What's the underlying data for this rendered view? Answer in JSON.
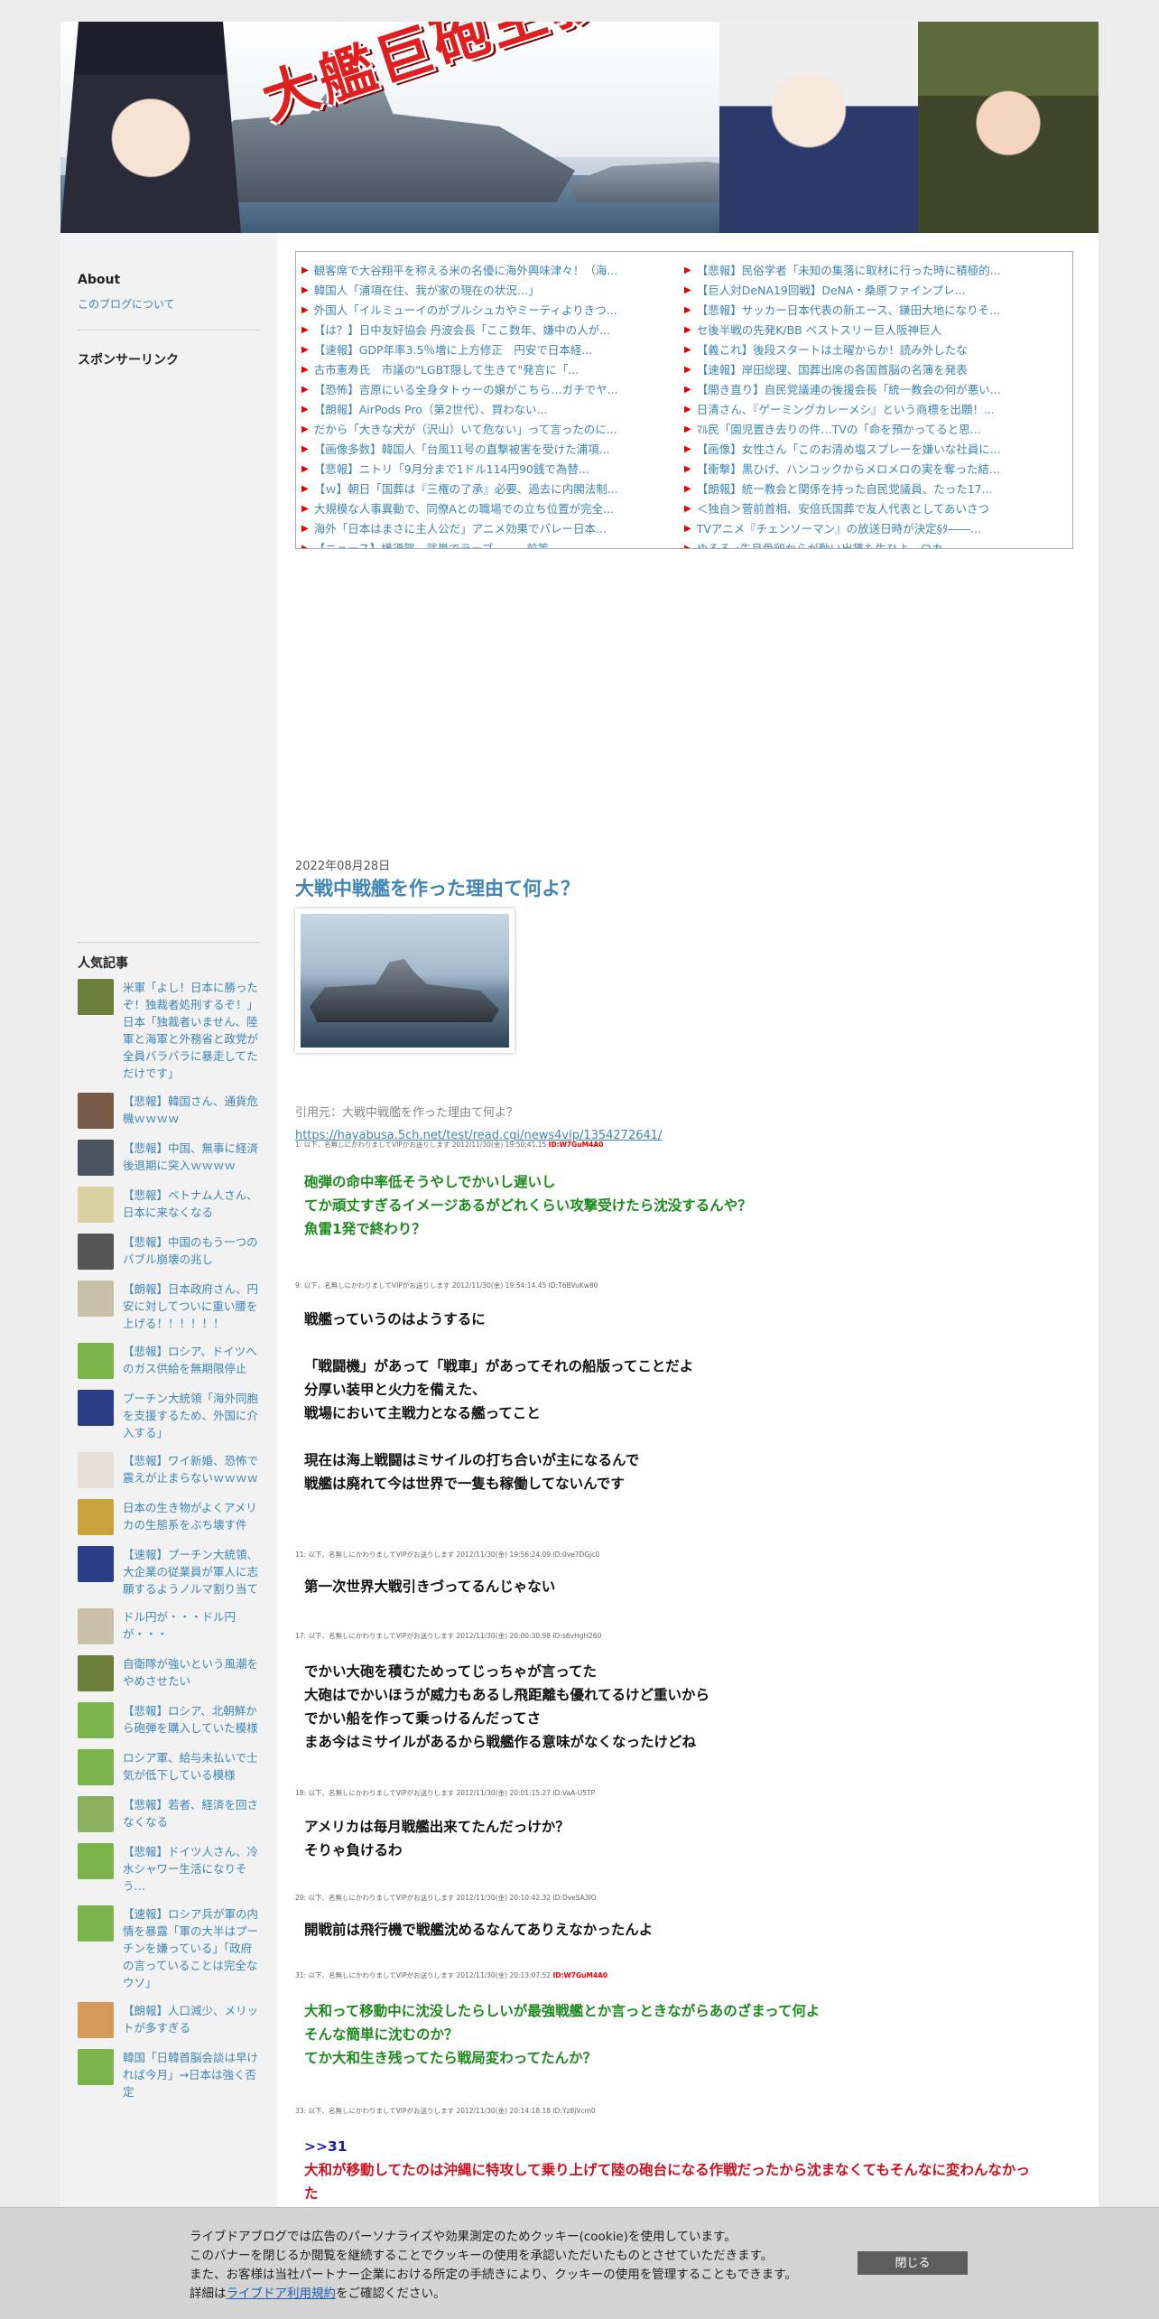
{
  "banner": {
    "title": "大艦巨砲主義！"
  },
  "sidebar": {
    "about_heading": "About",
    "about_link": "このブログについて",
    "sponsor_heading": "スポンサーリンク",
    "popular_heading": "人気記事",
    "popular": [
      {
        "text": "米軍「よし！日本に勝ったぞ！独裁者処刑するぞ！」日本「独裁者いません、陸軍と海軍と外務省と政党が全員バラバラに暴走してただけです」",
        "color": "#6b7f3a"
      },
      {
        "text": "【悲報】韓国さん、通貨危機ｗｗｗｗ",
        "color": "#7a5a48"
      },
      {
        "text": "【悲報】中国、無事に経済後退期に突入ｗｗｗｗ",
        "color": "#4a5560"
      },
      {
        "text": "【悲報】ベトナム人さん、日本に来なくなる",
        "color": "#d9d2a0"
      },
      {
        "text": "【悲報】中国のもう一つのバブル崩壊の兆し",
        "color": "#555"
      },
      {
        "text": "【朗報】日本政府さん、円安に対してついに重い腰を上げる！！！！！！",
        "color": "#c8c0a8"
      },
      {
        "text": "【悲報】ロシア、ドイツへのガス供給を無期限停止",
        "color": "#7bb44a"
      },
      {
        "text": "プーチン大統領「海外同胞を支援するため、外国に介入する」",
        "color": "#2d3e88"
      },
      {
        "text": "【悲報】ワイ新婚、恐怖で震えが止まらないｗｗｗｗ",
        "color": "#e8e0d8"
      },
      {
        "text": "日本の生き物がよくアメリカの生態系をぶち壊す件",
        "color": "#c9a43a"
      },
      {
        "text": "【速報】プーチン大統領、大企業の従業員が軍人に志願するようノルマ割り当て",
        "color": "#2d3e88"
      },
      {
        "text": "ドル円が・・・ドル円が・・・",
        "color": "#c8c0a8"
      },
      {
        "text": "自衛隊が強いという風潮をやめさせたい",
        "color": "#6b7f3a"
      },
      {
        "text": "【悲報】ロシア、北朝鮮から砲弾を購入していた模様",
        "color": "#7bb44a"
      },
      {
        "text": "ロシア軍、給与未払いで士気が低下している模様",
        "color": "#7bb44a"
      },
      {
        "text": "【悲報】若者、経済を回さなくなる",
        "color": "#8ab060"
      },
      {
        "text": "【悲報】ドイツ人さん、冷水シャワー生活になりそう…",
        "color": "#7bb44a"
      },
      {
        "text": "【速報】ロシア兵が軍の内情を暴露「軍の大半はプーチンを嫌っている」「政府の言っていることは完全なウソ」",
        "color": "#7bb44a"
      },
      {
        "text": "【朗報】人口減少、メリットが多すぎる",
        "color": "#d89a5a"
      },
      {
        "text": "韓国「日韓首脳会談は早ければ今月」→日本は強く否定",
        "color": "#7bb44a"
      }
    ]
  },
  "rss": {
    "left": [
      "観客席で大谷翔平を称える米の名優に海外興味津々！（海...",
      "韓国人「浦項在住、我が家の現在の状況…」",
      "外国人「イルミューイのがプルシュカやミーティよりきつ...",
      "【は？】日中友好協会 丹波会長「ここ数年、嫌中の人が...",
      "【速報】GDP年率3.5％増に上方修正　円安で日本経...",
      "古市憲寿氏　市議の\"LGBT隠して生きて\"発言に「...",
      "【恐怖】吉原にいる全身タトゥーの嬢がこちら…ガチでヤ...",
      "【朗報】AirPods Pro（第2世代）、買わない...",
      "だから「大きな犬が（沢山）いて危ない」って言ったのに...",
      "【画像多数】韓国人「台風11号の直撃被害を受けた浦項...",
      "【悲報】ニトリ「9月分まで1ドル114円90銭で為替...",
      "【ｗ】朝日「国葬は『三権の了承』必要、過去に内閣法制...",
      "大規模な人事異動で、同僚Aとの職場での立ち位置が完全...",
      "海外「日本はまさに主人公だ」アニメ効果でバレー日本...",
      "【ニュース】横須賀　武巣でラーブ　...　前等"
    ],
    "right": [
      "【悲報】民俗学者「未知の集落に取材に行った時に積極的...",
      "【巨人対DeNA19回戦】DeNA・桑原ファインプレ...",
      "【悲報】サッカー日本代表の新エース、鎌田大地になりそ...",
      "セ後半戦の先発K/BB ベストスリー巨人阪神巨人",
      "【義これ】後段スタートは土曜からか！読み外したな",
      "【速報】岸田総理、国葬出席の各国首脳の名簿を発表",
      "【開き直り】自民党議連の後援会長「統一教会の何が悪い...",
      "日清さん、『ゲーミングカレーメシ』という商標を出願！...",
      "ﾏﾙ民「園児置き去りの件…TVの「命を預かってると思...",
      "【画像】女性さん「このお清め塩スプレーを嫌いな社員に...",
      "【衝撃】黒ひげ、ハンコックからメロメロの実を奪った結...",
      "【朗報】統一教会と関係を持った自民党議員、たった17...",
      "＜独自＞菅前首相、安倍氏国葬で友人代表としてあいさつ",
      "TVアニメ『チェンソーマン』の放送日時が決定§ﾀ――...",
      "ゆるる→先月骨卵からが動い出賃も生ひよ、ロカ..."
    ]
  },
  "post": {
    "date": "2022年08月28日",
    "title": "大戦中戦艦を作った理由て何よ？",
    "quote_source": "引用元：大戦中戦艦を作った理由て何よ？",
    "quote_url": "https://hayabusa.5ch.net/test/read.cgi/news4vip/1354272641/",
    "responses": [
      {
        "meta": "1: 以下、名無しにかわりましてVIPがお送りします 2012/11/30(金) 19:50:41.15 ",
        "uid": "ID:W7GuM4A0",
        "style": "green",
        "lines": [
          "砲弾の命中率低そうやしでかいし遅いし",
          "てか頑丈すぎるイメージあるがどれくらい攻撃受けたら沈没するんや？",
          "魚雷1発で終わり？"
        ]
      },
      {
        "meta": "9: 以下、名無しにかわりましてVIPがお送りします 2012/11/30(金) 19:54:14.45 ID:T6BVuKw80",
        "uid": "",
        "style": "black",
        "lines": [
          "戦艦っていうのはようするに",
          "",
          "「戦闘機」があって「戦車」があってそれの船版ってことだよ",
          "分厚い装甲と火力を備えた、",
          "戦場において主戦力となる艦ってこと",
          "",
          "現在は海上戦闘はミサイルの打ち合いが主になるんで",
          "戦艦は廃れて今は世界で一隻も稼働してないんです"
        ]
      },
      {
        "meta": "11: 以下、名無しにかわりましてVIPがお送りします 2012/11/30(金) 19:56:24.09 ID:0ve7DGjc0",
        "uid": "",
        "style": "black",
        "lines": [
          "第一次世界大戦引きづってるんじゃない"
        ]
      },
      {
        "meta": "17: 以下、名無しにかわりましてVIPがお送りします 2012/11/30(金) 20:00:30.98 ID:s6vHgH260",
        "uid": "",
        "style": "black",
        "lines": [
          "でかい大砲を積むためってじっちゃが言ってた",
          "大砲はでかいほうが威力もあるし飛距離も優れてるけど重いから",
          "でかい船を作って乗っけるんだってさ",
          "まあ今はミサイルがあるから戦艦作る意味がなくなったけどね"
        ]
      },
      {
        "meta": "18: 以下、名無しにかわりましてVIPがお送りします 2012/11/30(金) 20:01:15.27 ID:VaA-U5TP",
        "uid": "",
        "style": "black",
        "lines": [
          "アメリカは毎月戦艦出来てたんだっけか？",
          "そりゃ負けるわ"
        ]
      },
      {
        "meta": "29: 以下、名無しにかわりましてVIPがお送りします 2012/11/30(金) 20:10:42.32 ID:DveSA3IO",
        "uid": "",
        "style": "black",
        "lines": [
          "開戦前は飛行機で戦艦沈めるなんてありえなかったんよ"
        ]
      },
      {
        "meta": "31: 以下、名無しにかわりましてVIPがお送りします 2012/11/30(金) 20:13:07.52 ",
        "uid": "ID:W7GuM4A0",
        "style": "green",
        "lines": [
          "大和って移動中に沈没したらしいが最強戦艦とか言っときながらあのざまって何よ",
          "そんな簡単に沈むのか？",
          "てか大和生き残ってたら戦局変わってたんか？"
        ]
      },
      {
        "meta": "33: 以下、名無しにかわりましてVIPがお送りします 2012/11/30(金) 20:14:18.18 ID:Yz8jVcm0",
        "uid": "",
        "style": "black",
        "anchor": ">>31",
        "lines_red": [
          "大和が移動してたのは沖縄に特攻して乗り上げて陸の砲台になる作戦だったから沈まなくてもそんなに変わんなかっ",
          "た"
        ]
      }
    ]
  },
  "cookie": {
    "line1": "ライブドアブログでは広告のパーソナライズや効果測定のためクッキー(cookie)を使用しています。",
    "line2": "このバナーを閉じるか閲覧を継続することでクッキーの使用を承認いただいたものとさせていただきます。",
    "line3": "また、お客様は当社パートナー企業における所定の手続きにより、クッキーの使用を管理することもできます。",
    "line4_prefix": "詳細は",
    "line4_link": "ライブドア利用規約",
    "line4_suffix": "をご確認ください。",
    "close_button": "閉じる"
  }
}
